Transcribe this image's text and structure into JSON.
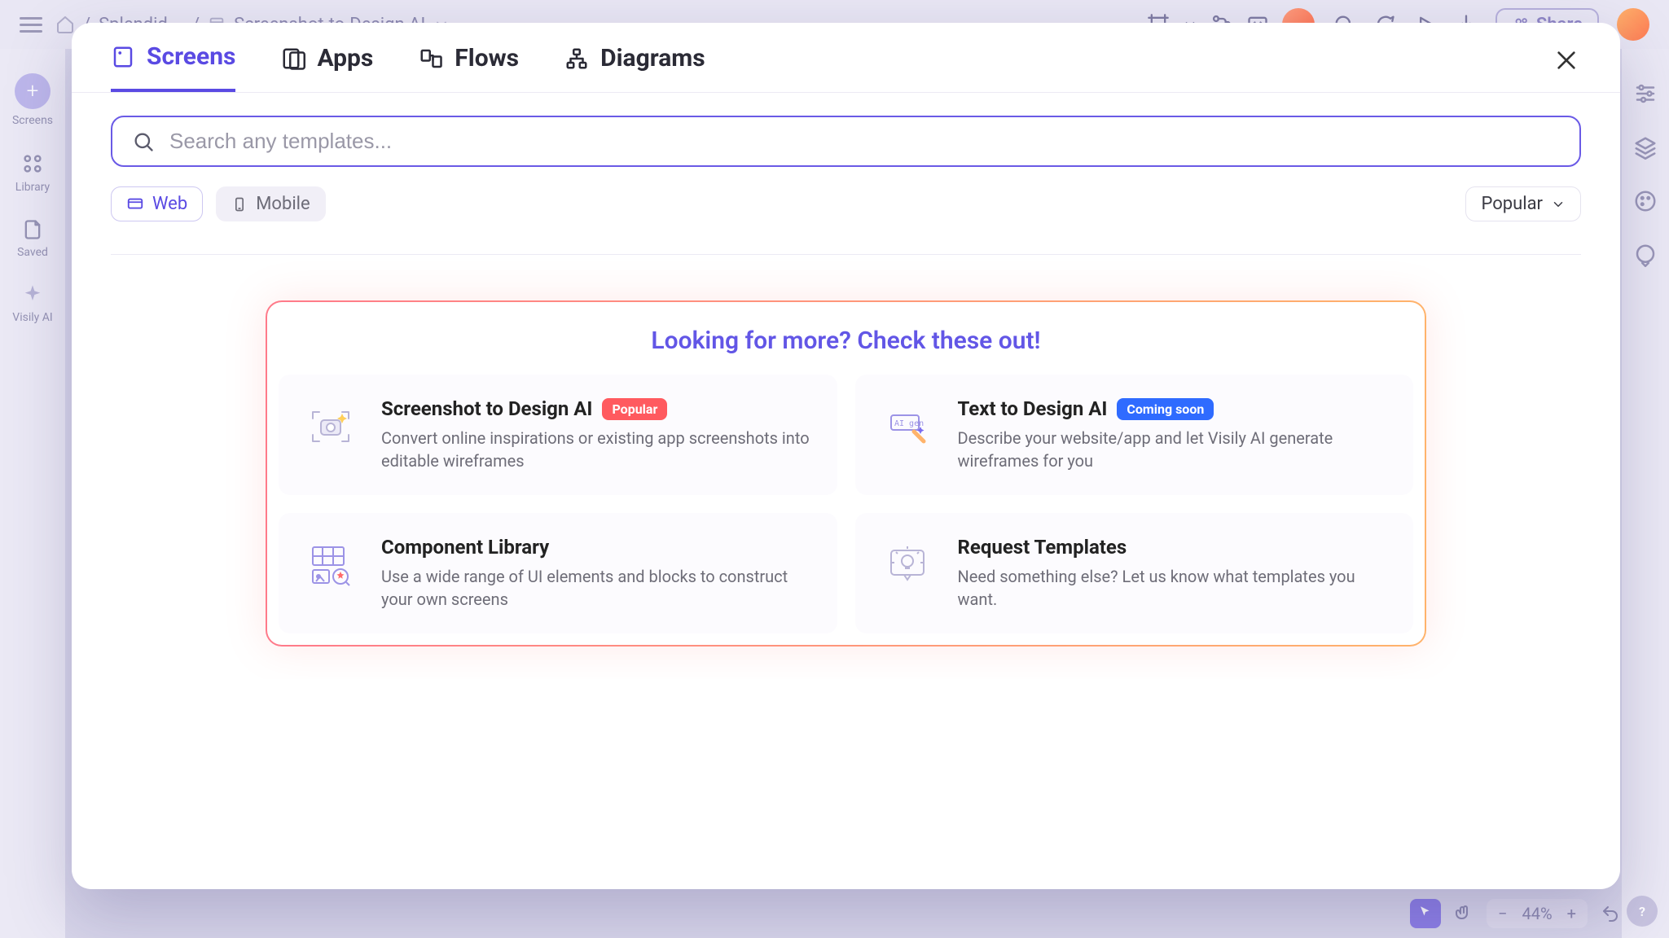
{
  "topbar": {
    "breadcrumb": {
      "project": "Splendid …",
      "page": "Screenshot-to-Design AI"
    },
    "share_label": "Share"
  },
  "leftbar": {
    "items": [
      {
        "label": "Screens"
      },
      {
        "label": "Library"
      },
      {
        "label": "Saved"
      },
      {
        "label": "Visily AI"
      }
    ]
  },
  "bottombar": {
    "zoom": "44%"
  },
  "modal": {
    "tabs": [
      {
        "label": "Screens"
      },
      {
        "label": "Apps"
      },
      {
        "label": "Flows"
      },
      {
        "label": "Diagrams"
      }
    ],
    "search": {
      "placeholder": "Search any templates..."
    },
    "filters": {
      "web": "Web",
      "mobile": "Mobile",
      "sort": "Popular"
    },
    "promo": {
      "title": "Looking for more? Check these out!",
      "cards": [
        {
          "title": "Screenshot to Design AI",
          "badge": "Popular",
          "badge_kind": "red",
          "desc": "Convert online inspirations or existing app screenshots into editable wireframes"
        },
        {
          "title": "Text to Design AI",
          "badge": "Coming soon",
          "badge_kind": "blue",
          "desc": "Describe your website/app and let Visily AI generate wireframes for you"
        },
        {
          "title": "Component Library",
          "desc": "Use a wide range of UI elements and blocks to construct your own screens"
        },
        {
          "title": "Request Templates",
          "desc": "Need something else? Let us know what templates you want."
        }
      ]
    }
  }
}
